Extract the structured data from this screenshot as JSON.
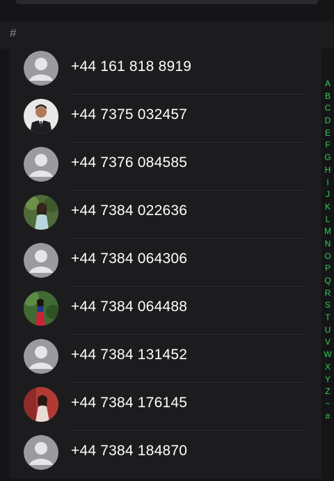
{
  "section": {
    "header": "#"
  },
  "contacts": [
    {
      "phone": "+44 161 818 8919",
      "avatar": "default-avatar"
    },
    {
      "phone": "+44 7375 032457",
      "avatar": "photo-man-suit"
    },
    {
      "phone": "+44 7376 084585",
      "avatar": "default-avatar"
    },
    {
      "phone": "+44 7384 022636",
      "avatar": "photo-woman-garden"
    },
    {
      "phone": "+44 7384 064306",
      "avatar": "default-avatar"
    },
    {
      "phone": "+44 7384 064488",
      "avatar": "photo-woman-red-dress"
    },
    {
      "phone": "+44 7384 131452",
      "avatar": "default-avatar"
    },
    {
      "phone": "+44 7384 176145",
      "avatar": "photo-woman-red-background"
    },
    {
      "phone": "+44 7384 184870",
      "avatar": "default-avatar"
    }
  ],
  "index_letters": [
    "A",
    "B",
    "C",
    "D",
    "E",
    "F",
    "G",
    "H",
    "I",
    "J",
    "K",
    "L",
    "M",
    "N",
    "O",
    "P",
    "Q",
    "R",
    "S",
    "T",
    "U",
    "V",
    "W",
    "X",
    "Y",
    "Z",
    "~",
    "#"
  ],
  "colors": {
    "accent": "#30d158",
    "background": "#151517",
    "list_bg": "#1c1c1e",
    "text": "#ffffff"
  }
}
